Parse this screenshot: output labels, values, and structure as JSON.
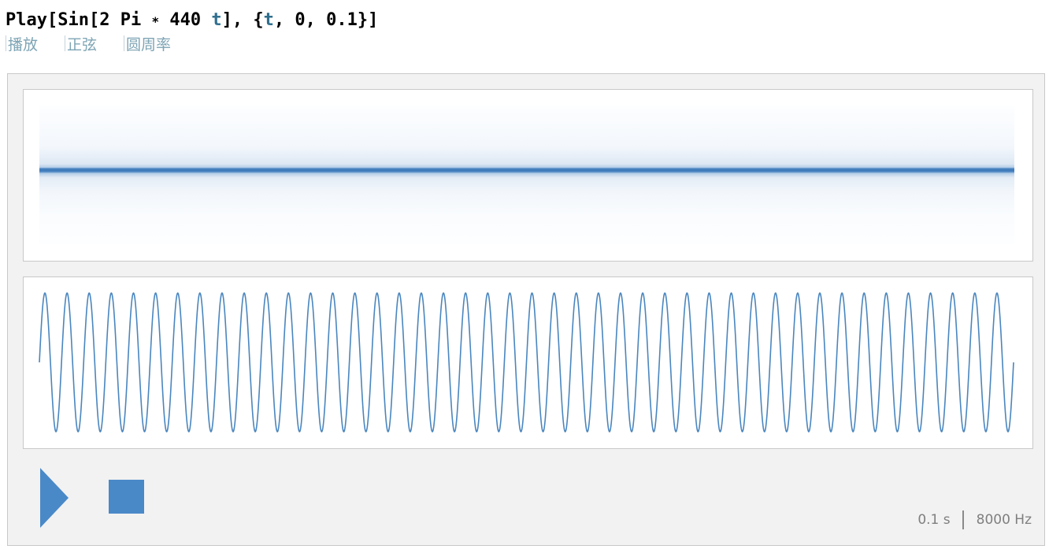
{
  "input": {
    "func": "Play",
    "open_bracket": "[",
    "sin": "Sin",
    "inner_open": "[",
    "two": "2",
    "pi": "Pi",
    "times": "∗",
    "freq": "440",
    "var": "t",
    "inner_close": "]",
    "comma1": ", ",
    "brace_open": "{",
    "iter_var": "t",
    "comma2": ", ",
    "start": "0",
    "comma3": ", ",
    "end": "0.1",
    "brace_close": "}",
    "close_bracket": "]"
  },
  "suggestions": [
    {
      "label": "播放"
    },
    {
      "label": "正弦"
    },
    {
      "label": "圆周率"
    }
  ],
  "audio": {
    "duration_label": "0.1 s",
    "sample_rate_label": "8000 Hz",
    "frequency_hz": 440,
    "duration_s": 0.1,
    "accent_color": "#4a89c8",
    "wave_color": "#4a86be",
    "play_icon": "play-icon",
    "stop_icon": "stop-icon"
  }
}
